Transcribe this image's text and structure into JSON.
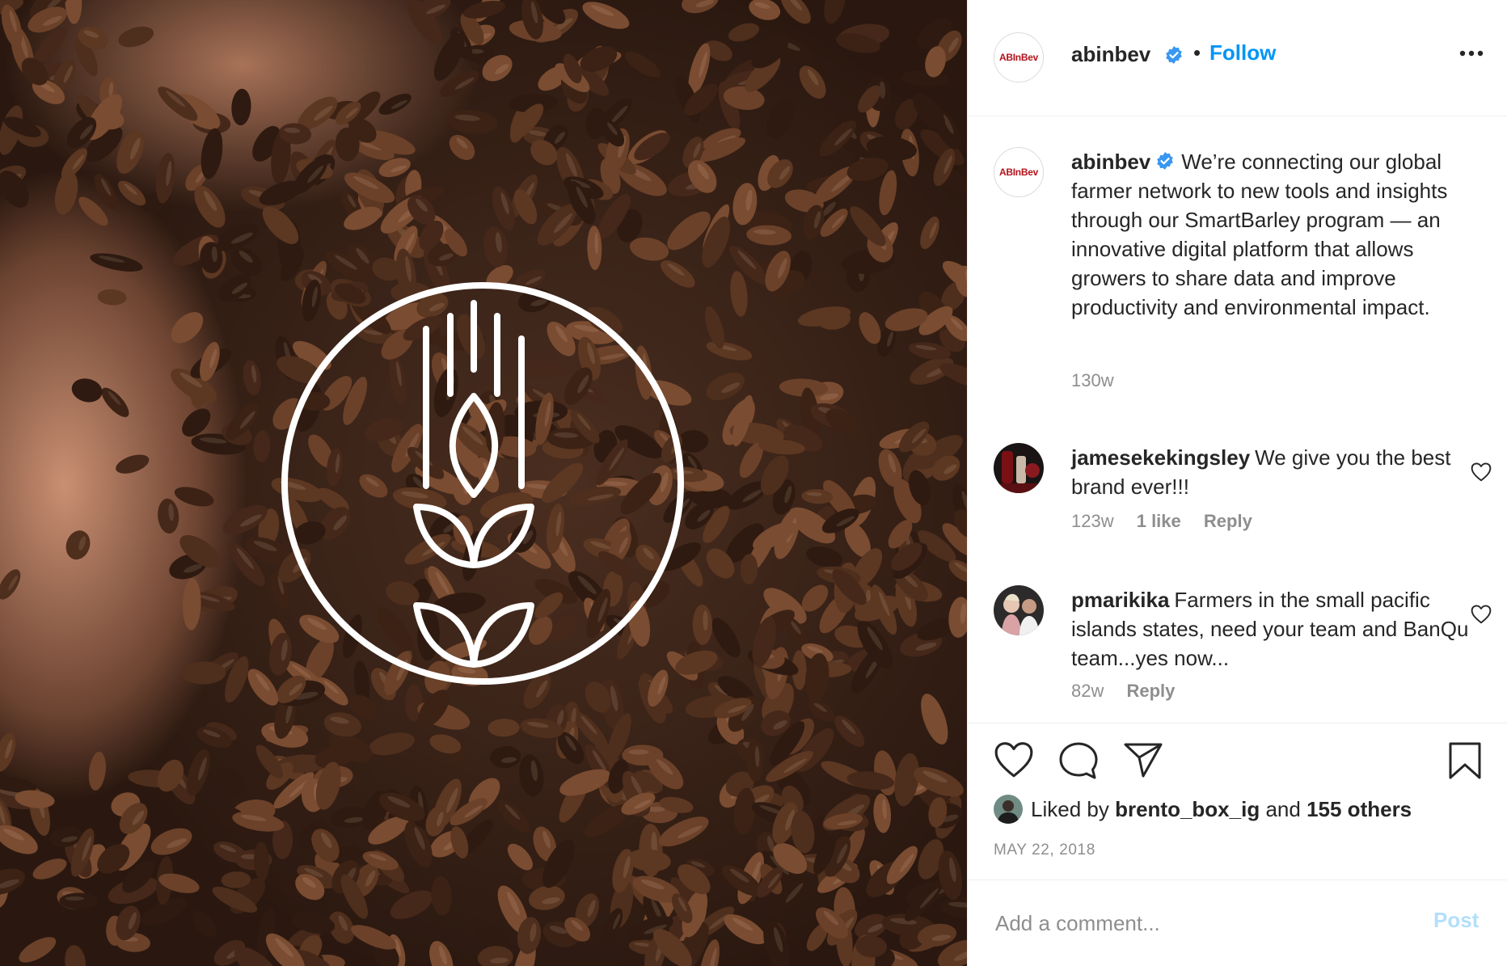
{
  "post": {
    "logo_text": "ABInBev",
    "username": "abinbev",
    "dot": "•",
    "follow_label": "Follow"
  },
  "caption": {
    "username": "abinbev",
    "text": "We’re connecting our global farmer network to new tools and insights through our SmartBarley program — an innovative digital platform that allows growers to share data and improve productivity and environmental impact.",
    "age": "130w"
  },
  "comments": [
    {
      "username": "jamesekekingsley",
      "text": "We give you the best brand ever!!!",
      "age": "123w",
      "likes": "1 like",
      "reply_label": "Reply"
    },
    {
      "username": "pmarikika",
      "text": "Farmers in the small pacific islands states, need your team and BanQu team...yes now...",
      "age": "82w",
      "reply_label": "Reply"
    }
  ],
  "likes": {
    "prefix": "Liked by",
    "user": "brento_box_ig",
    "middle": "and",
    "others": "155 others"
  },
  "date": "MAY 22, 2018",
  "composer": {
    "placeholder": "Add a comment...",
    "post_label": "Post"
  },
  "colors": {
    "accent": "#0095f6",
    "verified": "#3897f0",
    "muted": "#8e8e8e",
    "brand_red": "#b3131b"
  },
  "icons": [
    "more-options-icon",
    "verified-badge-icon",
    "heart-icon",
    "comment-icon",
    "share-icon",
    "bookmark-icon",
    "barley-logo-icon"
  ]
}
